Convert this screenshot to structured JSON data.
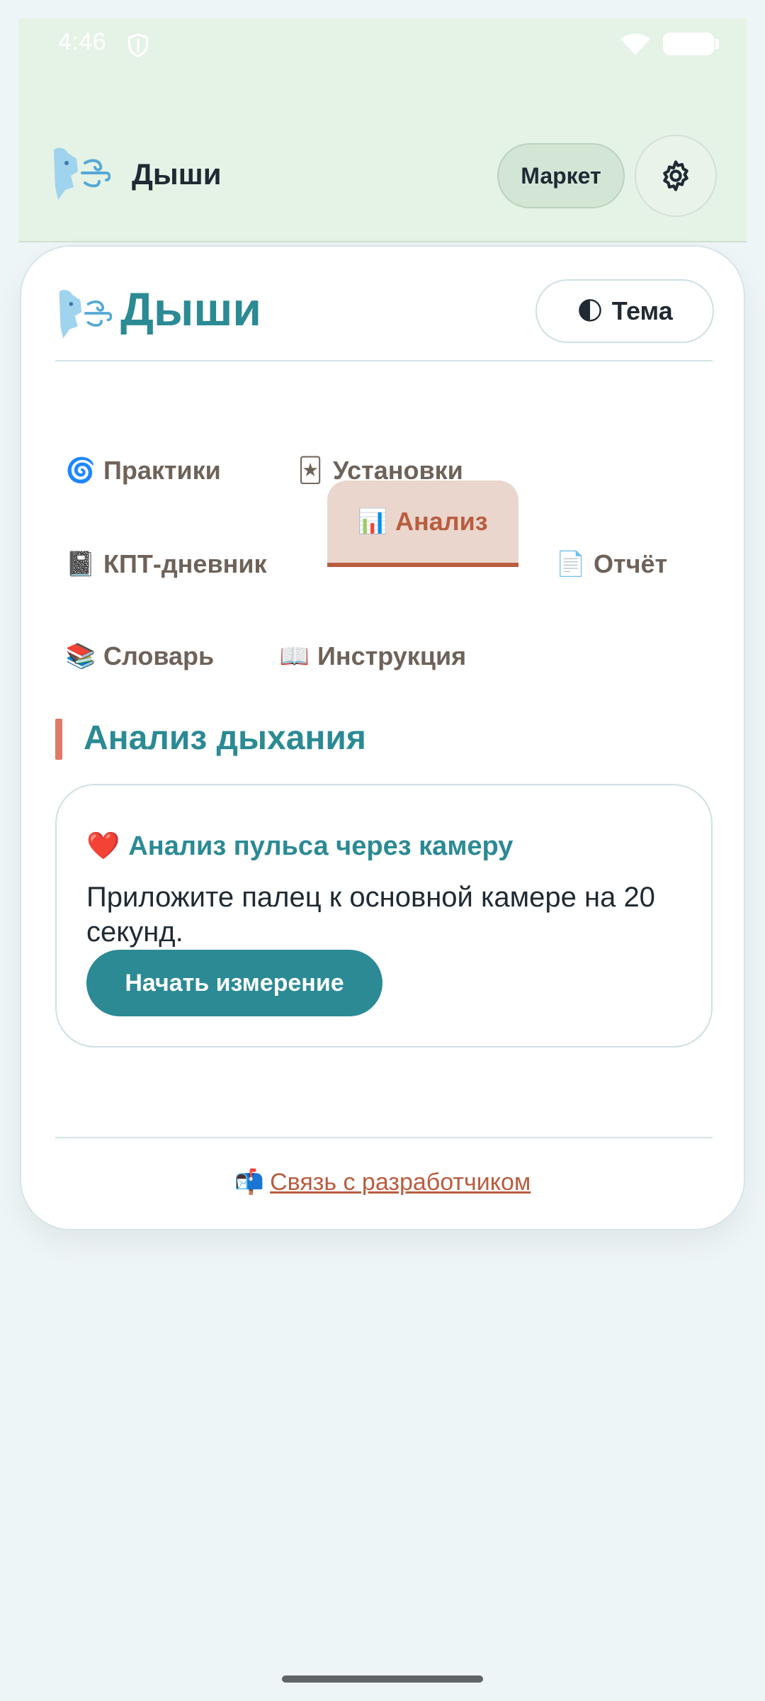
{
  "status_bar": {
    "time": "4:46",
    "icons": [
      "shield-icon",
      "wifi-icon",
      "battery-icon"
    ]
  },
  "app_bar": {
    "title": "Дыши",
    "market_label": "Маркет",
    "settings_icon": "gear-icon"
  },
  "card": {
    "title": "Дыши",
    "theme_label": "Тема",
    "theme_icon": "🌓"
  },
  "tabs": [
    {
      "icon": "🌀",
      "label": "Практики",
      "active": false
    },
    {
      "icon": "🃏",
      "label": "Установки",
      "active": false
    },
    {
      "icon": "📓",
      "label": "КПТ-дневник",
      "active": false
    },
    {
      "icon": "📊",
      "label": "Анализ",
      "active": true
    },
    {
      "icon": "📄",
      "label": "Отчёт",
      "active": false
    },
    {
      "icon": "📚",
      "label": "Словарь",
      "active": false
    },
    {
      "icon": "📖",
      "label": "Инструкция",
      "active": false
    }
  ],
  "section": {
    "title": "Анализ дыхания"
  },
  "pulse": {
    "icon": "❤️",
    "title": "Анализ пульса через камеру",
    "text": "Приложите палец к основной камере на 20 секунд.",
    "button_label": "Начать измерение"
  },
  "footer": {
    "icon": "📬",
    "contact_label": "Связь с разработчиком"
  },
  "colors": {
    "accent": "#2b8a94",
    "active_tab": "#b95d3f",
    "top_bar_bg": "#e5f2e6",
    "page_bg": "#eef5f6"
  }
}
